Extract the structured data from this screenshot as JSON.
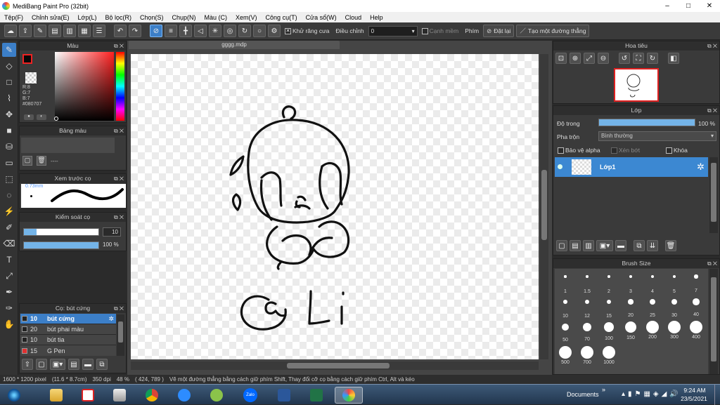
{
  "window": {
    "title": "MediBang Paint Pro (32bit)",
    "minimize": "–",
    "maximize": "□",
    "close": "✕"
  },
  "menu": [
    "Tệp(F)",
    "Chỉnh sửa(E)",
    "Lớp(L)",
    "Bộ lọc(R)",
    "Chọn(S)",
    "Chụp(N)",
    "Màu (C)",
    "Xem(V)",
    "Công cụ(T)",
    "Cửa sổ(W)",
    "Cloud",
    "Help"
  ],
  "toolbar": {
    "antialias_label": "Khử răng cưa",
    "adjust_label": "Điều chỉnh",
    "adjust_value": "0",
    "edge_label": "Cạnh mềm",
    "key_label": "Phím",
    "reset_label": "Đặt lại",
    "straight_line_label": "Tạo một đường thẳng"
  },
  "color_panel": {
    "title": "Màu",
    "r": "R:8",
    "g": "G:7",
    "b": "B:7",
    "hex": "#080707",
    "primary_color": "#080707",
    "hue_color": "#ff2020"
  },
  "palette_panel": {
    "title": "Bảng màu",
    "dashes": "----"
  },
  "brush_preview_panel": {
    "title": "Xem trước cọ",
    "size_text": "0.73mm"
  },
  "brush_control_panel": {
    "title": "Kiểm soát cọ",
    "size_value": "10",
    "size_fraction": 0.17,
    "opacity_value": "100 %",
    "opacity_fraction": 1.0
  },
  "brush_list_panel": {
    "title": "Cọ: bút cứng",
    "items": [
      {
        "size": "10",
        "name": "bút cứng",
        "selected": true,
        "color": "#222222"
      },
      {
        "size": "20",
        "name": "bút phai màu",
        "selected": false,
        "color": "#222222"
      },
      {
        "size": "10",
        "name": "bút tia",
        "selected": false,
        "color": "#222222"
      },
      {
        "size": "15",
        "name": "G Pen",
        "selected": false,
        "color": "#e03030"
      }
    ]
  },
  "document": {
    "tab_name": "gggg.mdp"
  },
  "navigator_panel": {
    "title": "Hoa tiêu"
  },
  "layer_panel": {
    "title": "Lớp",
    "opacity_label": "Độ trong",
    "opacity_value": "100 %",
    "opacity_fraction": 1.0,
    "blend_label": "Pha trộn",
    "blend_value": "Bình thường",
    "protect_alpha_label": "Bảo vệ alpha",
    "clip_label": "Xén bớt",
    "lock_label": "Khóa",
    "layer_name": "Lớp1"
  },
  "brush_size_panel": {
    "title": "Brush Size",
    "sizes": [
      "1",
      "1.5",
      "2",
      "3",
      "4",
      "5",
      "7",
      "10",
      "12",
      "15",
      "20",
      "25",
      "30",
      "40",
      "50",
      "70",
      "100",
      "150",
      "200",
      "300",
      "400",
      "500",
      "700",
      "1000"
    ]
  },
  "status": {
    "dimensions": "1600 * 1200 pixel",
    "physical": "(11.6 * 8.7cm)",
    "dpi": "350 dpi",
    "zoom": "48 %",
    "cursor": "( 424, 789 )",
    "hint": "Vẽ một đường thẳng bằng cách giữ phím Shift, Thay đổi cỡ cọ bằng cách giữ phím Ctrl, Alt và kéo"
  },
  "taskbar": {
    "documents_label": "Documents",
    "chevron": "»",
    "time": "9:24 AM",
    "date": "23/5/2021",
    "zalo_label": "Zalo"
  }
}
